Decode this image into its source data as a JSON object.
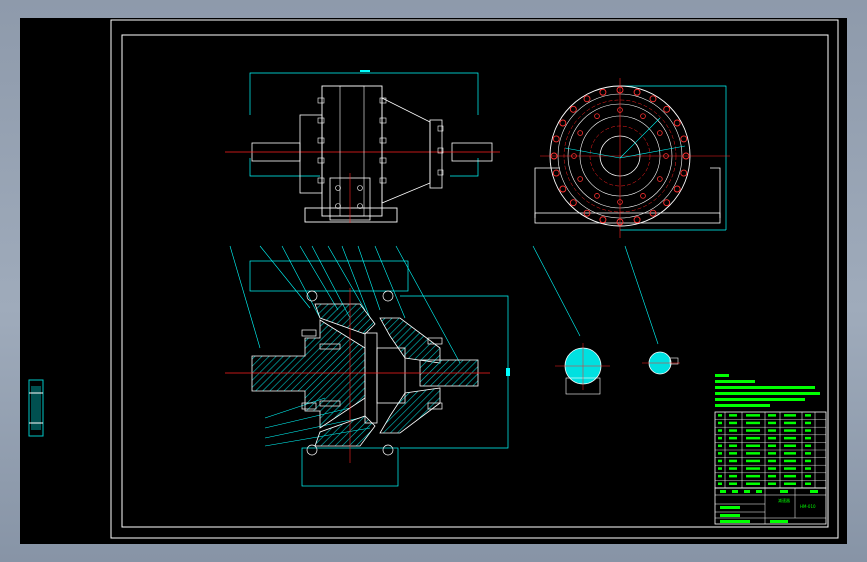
{
  "drawing": {
    "view_top": "front-view",
    "view_side": "side-view",
    "view_section": "section-view",
    "title_block": {
      "name_cell": "减速器",
      "drawing_no": "HM-010"
    },
    "colors": {
      "background": "#000000",
      "frame": "#ffffff",
      "outline": "#ffffff",
      "dimension": "#00ffff",
      "center_line": "#ff2020",
      "hatch": "#00c8c8",
      "notes": "#00ff00"
    }
  }
}
